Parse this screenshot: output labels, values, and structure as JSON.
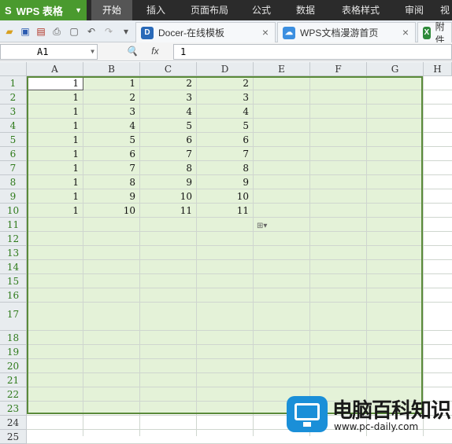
{
  "app": {
    "name": "WPS 表格",
    "logo": "S"
  },
  "menu": [
    "开始",
    "插入",
    "页面布局",
    "公式",
    "数据",
    "表格样式",
    "审阅",
    "视"
  ],
  "toolbar_icons": [
    "open-folder-icon",
    "save-icon",
    "export-pdf-icon",
    "print-icon",
    "print-preview-icon",
    "undo-icon",
    "redo-icon",
    "customize-dropdown-icon"
  ],
  "tabs": [
    {
      "label": "Docer-在线模板",
      "icon": "D"
    },
    {
      "label": "WPS文档漫游首页",
      "icon": "☁"
    },
    {
      "label": "附件",
      "icon": "X"
    }
  ],
  "formula_bar": {
    "cell_ref": "A1",
    "fx": "fx",
    "value": "1"
  },
  "columns": [
    "A",
    "B",
    "C",
    "D",
    "E",
    "F",
    "G",
    "H"
  ],
  "rows": [
    "1",
    "2",
    "3",
    "4",
    "5",
    "6",
    "7",
    "8",
    "9",
    "10",
    "11",
    "12",
    "13",
    "14",
    "15",
    "16",
    "17",
    "18",
    "19",
    "20",
    "21",
    "22",
    "23",
    "24",
    "25"
  ],
  "cells": [
    [
      "1",
      "1",
      "2",
      "2"
    ],
    [
      "1",
      "2",
      "3",
      "3"
    ],
    [
      "1",
      "3",
      "4",
      "4"
    ],
    [
      "1",
      "4",
      "5",
      "5"
    ],
    [
      "1",
      "5",
      "6",
      "6"
    ],
    [
      "1",
      "6",
      "7",
      "7"
    ],
    [
      "1",
      "7",
      "8",
      "8"
    ],
    [
      "1",
      "8",
      "9",
      "9"
    ],
    [
      "1",
      "9",
      "10",
      "10"
    ],
    [
      "1",
      "10",
      "11",
      "11"
    ]
  ],
  "watermark": {
    "title": "电脑百科知识",
    "url": "www.pc-daily.com"
  },
  "colors": {
    "selection": "#e4f2d8",
    "accent": "#5a8a3a",
    "menubar": "#2b2b2b",
    "brand": "#4a9a2e"
  }
}
